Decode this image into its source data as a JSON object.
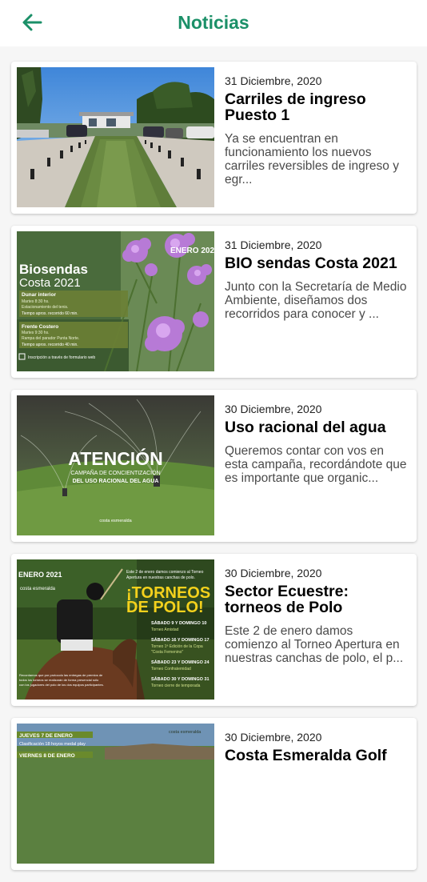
{
  "header": {
    "title": "Noticias",
    "back_icon": "arrow-left-icon",
    "accent_color": "#1b9068"
  },
  "news": [
    {
      "date": "31 Diciembre, 2020",
      "title": "Carriles de ingreso Puesto 1",
      "excerpt": "Ya se encuentran en funcionamiento los nuevos carriles reversibles de ingreso y egr..."
    },
    {
      "date": "31 Diciembre, 2020",
      "title": "BIO sendas Costa 2021",
      "excerpt": "Junto con la Secretaría de Medio Ambiente, diseñamos dos recorridos para conocer y ...",
      "image": {
        "corner": "ENERO 2021",
        "brand_line1": "Biosendas",
        "brand_line2": "Costa 2021",
        "route1_title": "Dunar interior",
        "route1_when": "Martes 8:30 hs.",
        "route1_where": "Estacionamiento del tenis.",
        "route1_time": "Tiempo aprox. recorrido 60 min.",
        "route2_title": "Frente Costero",
        "route2_when": "Martes 9:30 hs.",
        "route2_where": "Rampa del parador Punta Norte.",
        "route2_time": "Tiempo aprox. recorrido 40 min.",
        "signup": "Inscripción a través de formulario web"
      }
    },
    {
      "date": "30 Diciembre, 2020",
      "title": "Uso racional del agua",
      "excerpt": "Queremos contar con vos en esta campaña, recordándote que es importante que organic...",
      "image": {
        "headline": "ATENCIÓN",
        "sub1": "CAMPAÑA DE CONCIENTIZACIÓN",
        "sub2": "DEL USO RACIONAL DEL AGUA",
        "brand": "costa esmeralda"
      }
    },
    {
      "date": "30 Diciembre, 2020",
      "title": "Sector Ecuestre: torneos de Polo",
      "excerpt": "Este 2 de enero damos comienzo al Torneo Apertura en nuestras canchas de polo, el p...",
      "image": {
        "corner": "ENERO 2021",
        "brand": "costa esmeralda",
        "intro1": "Este 2 de enero damos comienzo al Torneo",
        "intro2": "Apertura en nuestras canchas de polo.",
        "headline1": "¡TORNEOS",
        "headline2": "DE POLO!",
        "e1_date": "SÁBADO 9 Y DOMINGO 10",
        "e1_name": "Torneo Amistad",
        "e2_date": "SÁBADO 16 Y DOMINGO 17",
        "e2_name": "Torneo 1ª Edición de la Copa",
        "e2_name2": "\"Costa Femenino\"",
        "e3_date": "SÁBADO 23 Y DOMINGO 24",
        "e3_name": "Torneo Confraternidad",
        "e4_date": "SÁBADO 30 Y DOMINGO 31",
        "e4_name": "Torneo cierre de temporada",
        "footer1": "Recordamos que por protocolo las entregas de premios de",
        "footer2": "todos los torneos se realizarán de forma presencial sólo",
        "footer3": "con los jugadores del polo de los dos equipos participantes."
      }
    },
    {
      "date": "30 Diciembre, 2020",
      "title": "Costa Esmeralda Golf",
      "excerpt": "",
      "image": {
        "tag1": "JUEVES 7 DE ENERO",
        "line1": "Clasificación 18 hoyos medal play",
        "tag2": "VIERNES 8 DE ENERO",
        "brand": "costa esmeralda"
      }
    }
  ]
}
